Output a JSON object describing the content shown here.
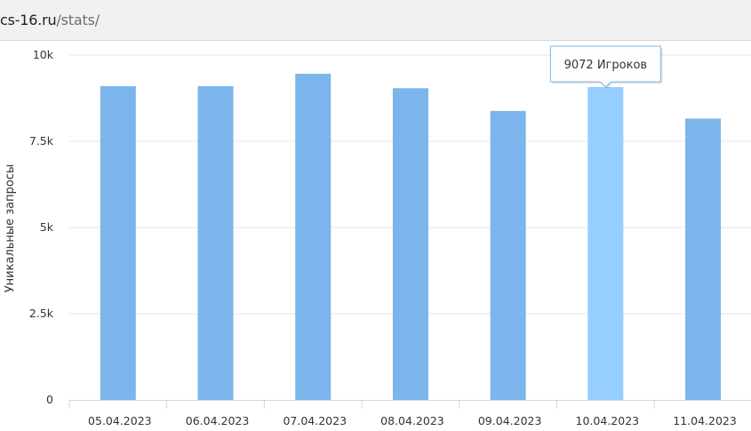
{
  "address_bar": {
    "domain": "cs-16.ru",
    "path": "/stats/"
  },
  "colors": {
    "bar": "#7cb5ec",
    "bar_hover": "#95ceff",
    "grid": "#e6e6e6",
    "axis": "#ccd6eb",
    "tooltip_border": "#7cb5ec"
  },
  "tooltip": {
    "text": "9072 Игроков",
    "category": "10.04.2023"
  },
  "chart_data": {
    "type": "bar",
    "categories": [
      "05.04.2023",
      "06.04.2023",
      "07.04.2023",
      "08.04.2023",
      "09.04.2023",
      "10.04.2023",
      "11.04.2023"
    ],
    "series": [
      {
        "values": [
          9100,
          9100,
          9460,
          9040,
          8380,
          9072,
          8160
        ]
      }
    ],
    "ylabel": "Уникальные запросы",
    "xlabel": "",
    "ylim": [
      0,
      10000
    ],
    "y_ticks": [
      0,
      2500,
      5000,
      7500,
      10000
    ],
    "y_tick_labels": [
      "0",
      "2.5k",
      "5k",
      "7.5k",
      "10k"
    ],
    "highlighted_category": "10.04.2023",
    "grid": true,
    "legend": "none"
  }
}
